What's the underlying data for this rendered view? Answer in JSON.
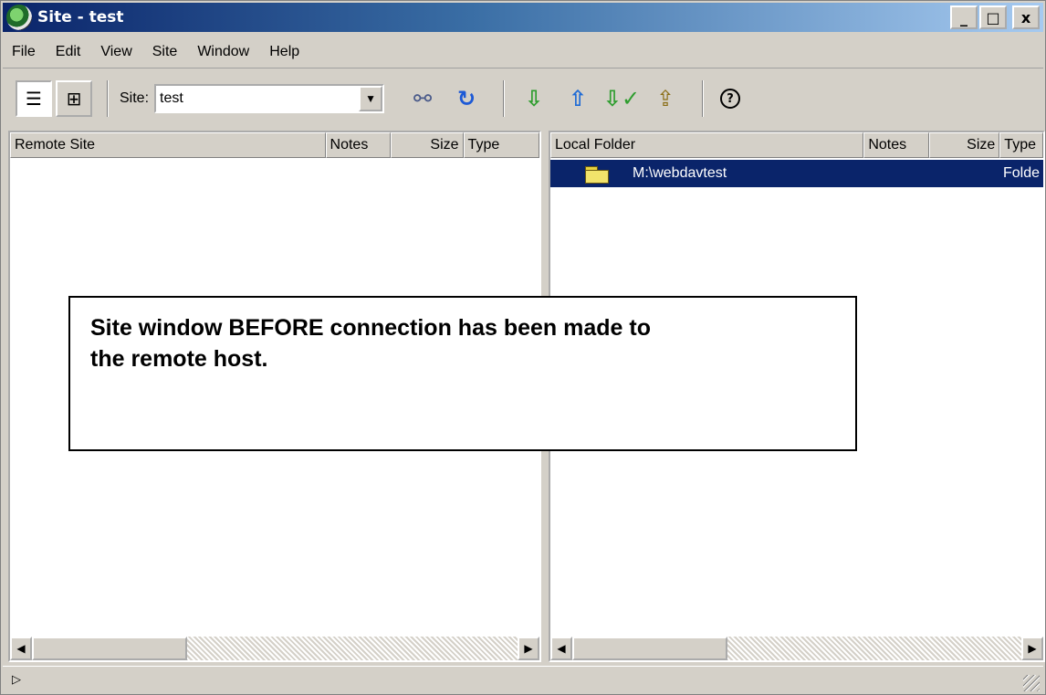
{
  "window": {
    "title": "Site - test",
    "controls": {
      "minimize": "_",
      "maximize": "□",
      "close": "x"
    }
  },
  "menu": [
    "File",
    "Edit",
    "View",
    "Site",
    "Window",
    "Help"
  ],
  "toolbar": {
    "site_label": "Site:",
    "site_value": "test",
    "icons": [
      "view-list-icon",
      "site-map-icon",
      "connect-icon",
      "refresh-icon",
      "get-icon",
      "put-icon",
      "check-out-icon",
      "check-in-icon",
      "help-icon"
    ]
  },
  "remote_pane": {
    "columns": [
      "Remote Site",
      "Notes",
      "Size",
      "Type"
    ],
    "rows": []
  },
  "local_pane": {
    "columns": [
      "Local Folder",
      "Notes",
      "Size",
      "Type"
    ],
    "rows": [
      {
        "name": "M:\\webdavtest",
        "type": "Folde",
        "selected": true
      }
    ]
  },
  "status": {
    "icon": "play-arrow-icon"
  },
  "callout": {
    "line1": "Site window BEFORE connection has been made to",
    "line2": "the remote host."
  }
}
